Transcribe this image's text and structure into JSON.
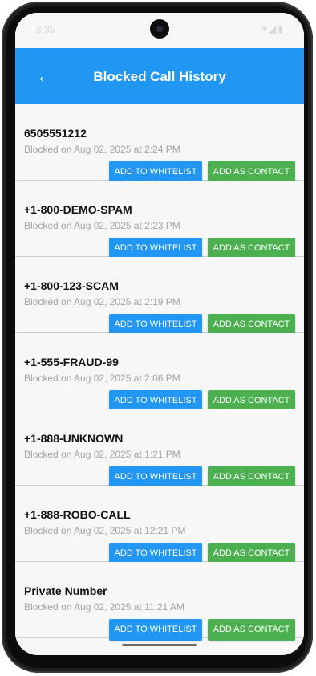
{
  "status_bar": {
    "time": "3:35",
    "icons_left": "▪ ●",
    "icons_right": "▾◢▮"
  },
  "appbar": {
    "back_icon": "←",
    "title": "Blocked Call History"
  },
  "buttons": {
    "whitelist_label": "ADD TO WHITELIST",
    "contact_label": "ADD AS CONTACT"
  },
  "calls": [
    {
      "number": "6505551212",
      "blocked": "Blocked on Aug 02, 2025 at 2:24 PM"
    },
    {
      "number": "+1-800-DEMO-SPAM",
      "blocked": "Blocked on Aug 02, 2025 at 2:23 PM"
    },
    {
      "number": "+1-800-123-SCAM",
      "blocked": "Blocked on Aug 02, 2025 at 2:19 PM"
    },
    {
      "number": "+1-555-FRAUD-99",
      "blocked": "Blocked on Aug 02, 2025 at 2:06 PM"
    },
    {
      "number": "+1-888-UNKNOWN",
      "blocked": "Blocked on Aug 02, 2025 at 1:21 PM"
    },
    {
      "number": "+1-888-ROBO-CALL",
      "blocked": "Blocked on Aug 02, 2025 at 12:21 PM"
    },
    {
      "number": "Private Number",
      "blocked": "Blocked on Aug 02, 2025 at 11:21 AM"
    }
  ],
  "colors": {
    "appbar": "#2196f3",
    "whitelist_button": "#2196f3",
    "contact_button": "#4caf50"
  }
}
